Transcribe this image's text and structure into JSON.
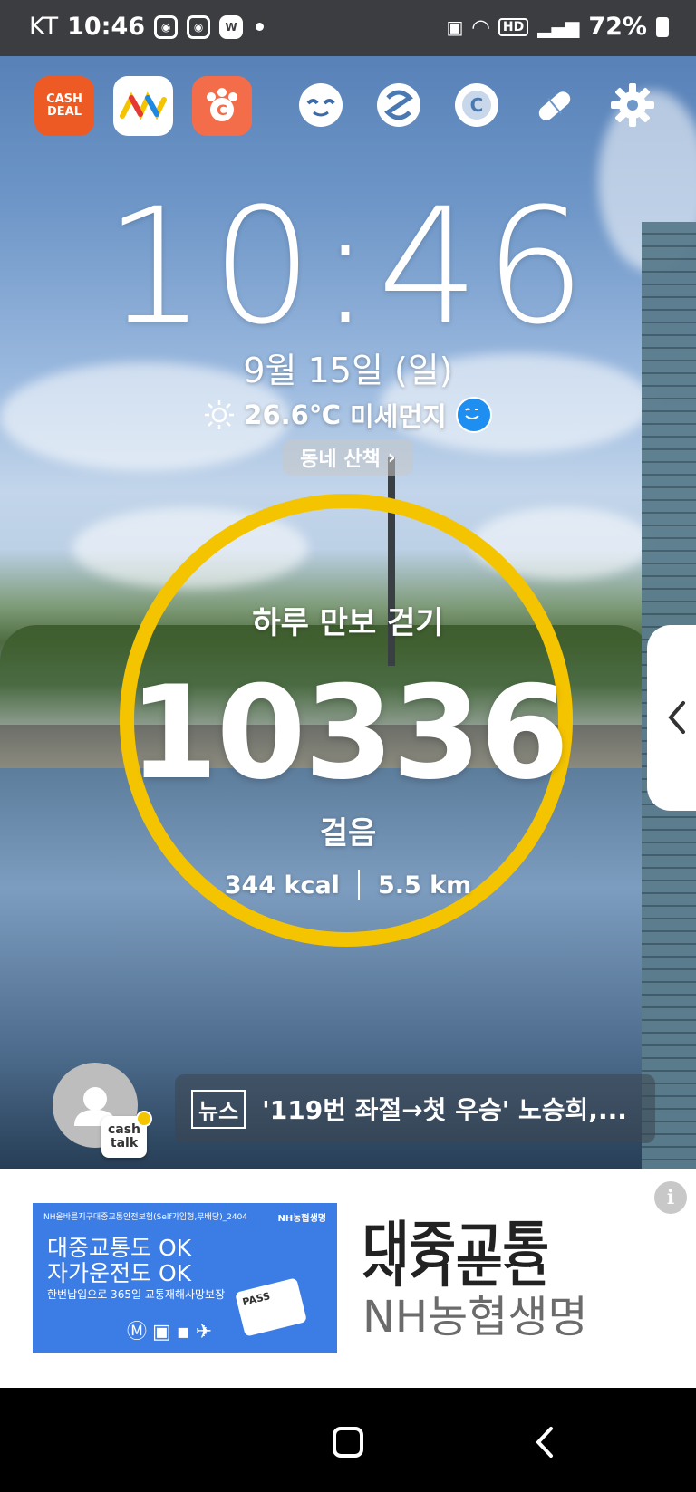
{
  "status_bar": {
    "carrier": "KT",
    "time": "10:46",
    "network": "HD",
    "battery": "72%"
  },
  "app_shortcuts": [
    {
      "name": "cash-deal",
      "label": "CASH DEAL"
    },
    {
      "name": "app-m"
    },
    {
      "name": "cashwalk-app"
    },
    {
      "name": "round-app-1"
    },
    {
      "name": "round-app-2"
    },
    {
      "name": "round-app-3"
    },
    {
      "name": "pill-app"
    },
    {
      "name": "settings"
    }
  ],
  "clock": {
    "time": "10:46",
    "date": "9월 15일 (일)"
  },
  "weather": {
    "temperature": "26.6℃",
    "dust_label": "미세먼지",
    "walk_chip": "동네 산책"
  },
  "pedometer": {
    "title": "하루 만보 걷기",
    "steps": "10336",
    "unit": "걸음",
    "calories": "344 kcal",
    "distance": "5.5 km"
  },
  "cashtalk": {
    "badge_line1": "cash",
    "badge_line2": "talk"
  },
  "news": {
    "tag": "뉴스",
    "headline": "'119번 좌절→첫 우승' 노승희,..."
  },
  "ad": {
    "banner_small": "NH올바른지구대중교통안전보험(Self가입형,무배당)_2404",
    "banner_brand": "NH농협생명",
    "banner_line1": "대중교통도 OK",
    "banner_line2": "자가운전도 OK",
    "banner_line3": "한번납입으로 365일 교통재해사망보장",
    "banner_card": "PASS",
    "info": "i",
    "title": "대중교통",
    "title_cut": "자가운전",
    "brand": "NH농협생명"
  },
  "colors": {
    "ring": "#f5c400",
    "statusbar": "#3c3d40",
    "ad_banner": "#3b7ce5",
    "cash_deal": "#ee5a24"
  }
}
